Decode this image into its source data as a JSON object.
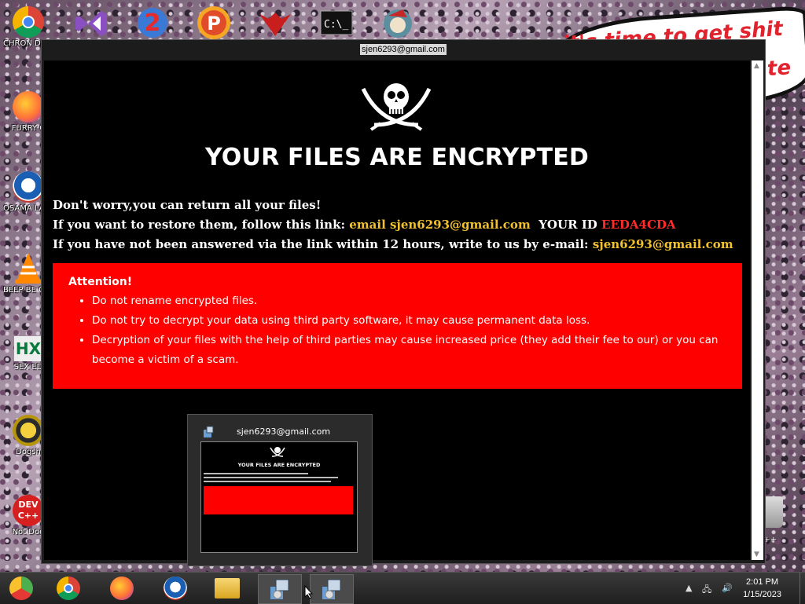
{
  "desktop": {
    "icons": [
      {
        "label": "CHRON DISEA"
      },
      {
        "label": "FURRY C"
      },
      {
        "label": "OSAMA LADEN"
      },
      {
        "label": "BEEP BE CAR"
      },
      {
        "label": "SEX ED"
      },
      {
        "label": "Dogsh"
      },
      {
        "label": "Not Dog"
      }
    ],
    "comic_text": "it's time to get shit",
    "comic_tail": "te",
    "trash_label": "n C++"
  },
  "window": {
    "title": "sjen6293@gmail.com",
    "headline": "YOUR FILES ARE ENCRYPTED",
    "line1": "Don't worry,you can return all your files!",
    "line2_prefix": "If you want to restore them, follow this link: ",
    "line2_email": "email sjen6293@gmail.com",
    "line2_id_label": "YOUR ID",
    "line2_id": "EEDA4CDA",
    "line3_prefix": "If you have not been answered via the link within 12 hours, write to us by e-mail: ",
    "line3_email": "sjen6293@gmail.com",
    "attention": {
      "title": "Attention!",
      "items": [
        "Do not rename encrypted files.",
        "Do not try to decrypt your data using third party software, it may cause permanent data loss.",
        "Decryption of your files with the help of third parties may cause increased price (they add their fee to our) or you can become a victim of a scam."
      ]
    }
  },
  "preview": {
    "title": "sjen6293@gmail.com",
    "thumb_headline": "YOUR FILES ARE ENCRYPTED"
  },
  "taskbar": {
    "time": "2:01 PM",
    "date": "1/15/2023"
  },
  "colors": {
    "attention_bg": "#ff0000",
    "email_yellow": "#f2c12e",
    "id_red": "#ff2b2b"
  }
}
